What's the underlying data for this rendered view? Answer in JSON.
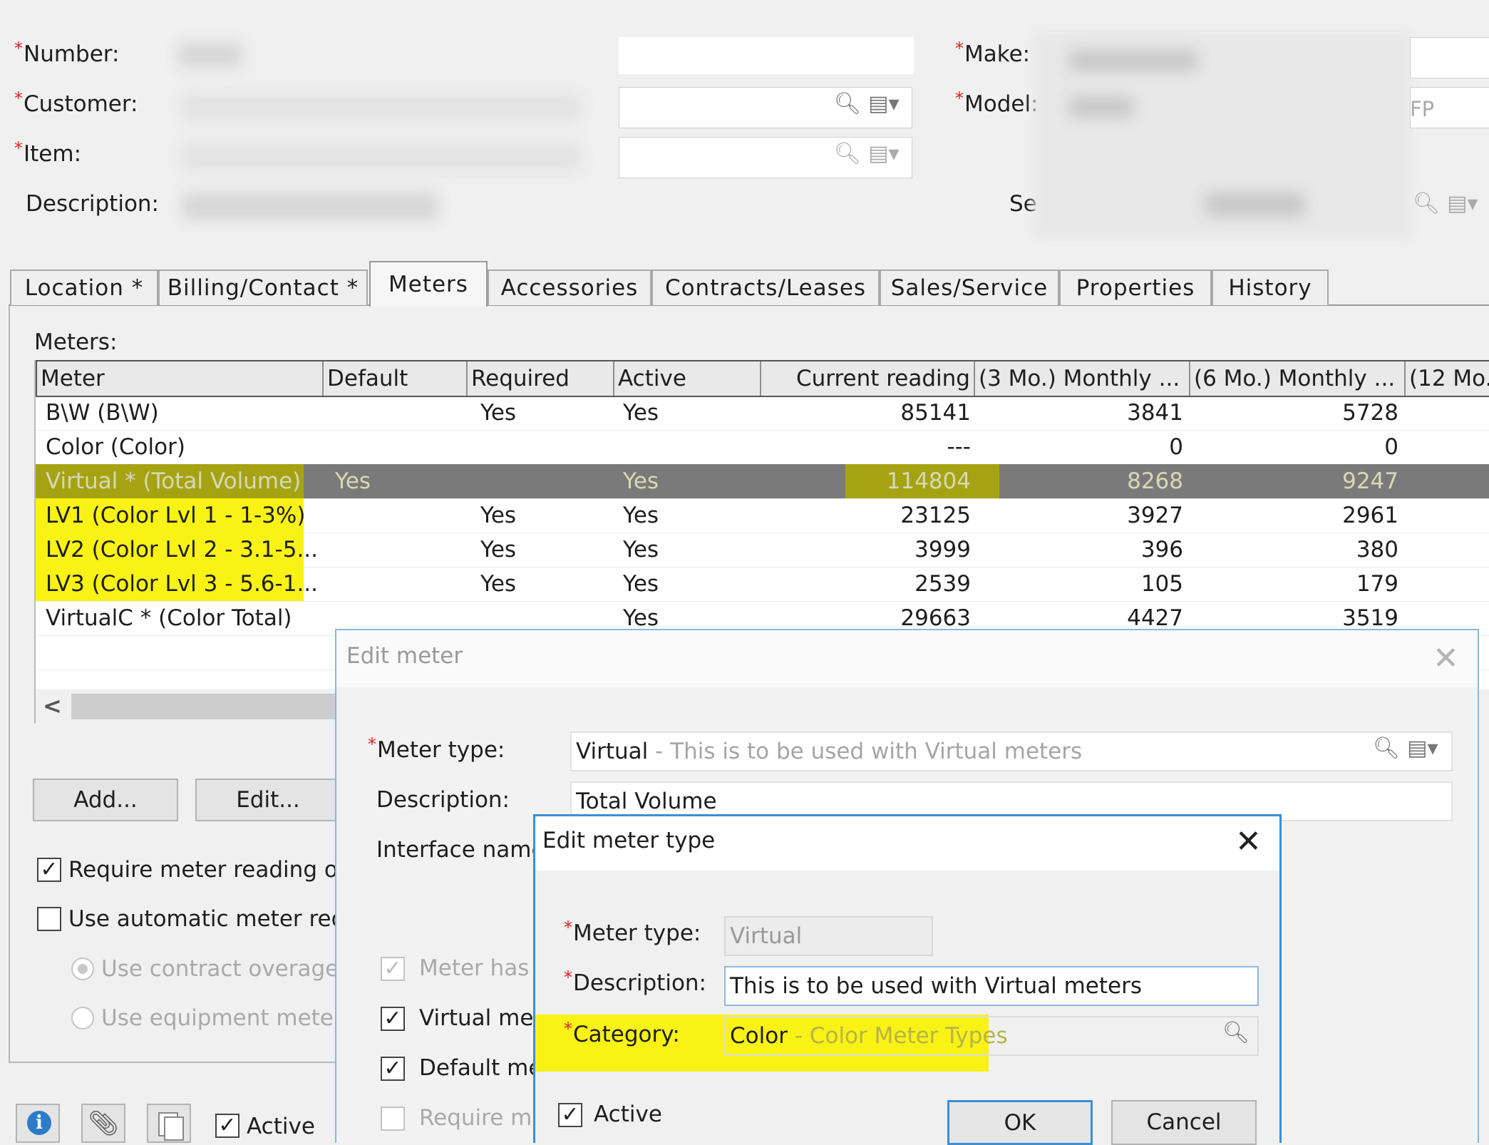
{
  "form": {
    "number_label": "Number:",
    "customer_label": "Customer:",
    "item_label": "Item:",
    "description_label": "Description:",
    "make_label": "Make:",
    "model_label": "Model:",
    "model_suffix": "FP",
    "se_label": "Se",
    "req_mark": "*"
  },
  "tabs": [
    {
      "label": "Location *"
    },
    {
      "label": "Billing/Contact *"
    },
    {
      "label": "Meters"
    },
    {
      "label": "Accessories"
    },
    {
      "label": "Contracts/Leases"
    },
    {
      "label": "Sales/Service"
    },
    {
      "label": "Properties"
    },
    {
      "label": "History"
    }
  ],
  "meters": {
    "section_label": "Meters:",
    "columns": [
      "Meter",
      "Default",
      "Required",
      "Active",
      "Current reading",
      "(3 Mo.) Monthly ...",
      "(6 Mo.) Monthly ...",
      "(12 Mo."
    ],
    "rows": [
      {
        "meter": "B\\W (B\\W)",
        "default": "",
        "required": "Yes",
        "active": "Yes",
        "current": "85141",
        "m3": "3841",
        "m6": "5728"
      },
      {
        "meter": "Color (Color)",
        "default": "",
        "required": "",
        "active": "",
        "current": "---",
        "m3": "0",
        "m6": "0"
      },
      {
        "meter": "Virtual * (Total Volume)",
        "default": "Yes",
        "required": "",
        "active": "Yes",
        "current": "114804",
        "m3": "8268",
        "m6": "9247"
      },
      {
        "meter": "LV1 (Color Lvl 1 - 1-3%)",
        "default": "",
        "required": "Yes",
        "active": "Yes",
        "current": "23125",
        "m3": "3927",
        "m6": "2961"
      },
      {
        "meter": "LV2 (Color Lvl 2 - 3.1-5...",
        "default": "",
        "required": "Yes",
        "active": "Yes",
        "current": "3999",
        "m3": "396",
        "m6": "380"
      },
      {
        "meter": "LV3 (Color Lvl 3 - 5.6-1...",
        "default": "",
        "required": "Yes",
        "active": "Yes",
        "current": "2539",
        "m3": "105",
        "m6": "179"
      },
      {
        "meter": "VirtualC * (Color Total)",
        "default": "",
        "required": "",
        "active": "Yes",
        "current": "29663",
        "m3": "4427",
        "m6": "3519"
      }
    ],
    "add_button": "Add...",
    "edit_button": "Edit...",
    "require_reading_label": "Require meter reading on",
    "use_automatic_label": "Use automatic meter requ",
    "use_contract_label": "Use contract overage",
    "use_equipment_label": "Use equipment meter r",
    "scroll_left": "<"
  },
  "bottom": {
    "active_label": "Active"
  },
  "edit_meter": {
    "title": "Edit meter",
    "meter_type_label": "Meter type:",
    "meter_type_value": "Virtual",
    "meter_type_hint": " - This is to be used with Virtual meters",
    "description_label": "Description:",
    "description_value": "Total Volume",
    "interface_label": "Interface name",
    "meter_has_label": "Meter has",
    "virtual_label": "Virtual met",
    "default_label": "Default me",
    "require_label": "Require me"
  },
  "edit_meter_type": {
    "title": "Edit meter type",
    "meter_type_label": "Meter type:",
    "meter_type_value": "Virtual",
    "description_label": "Description:",
    "description_value": "This is to be used with Virtual meters",
    "category_label": "Category:",
    "category_value": "Color",
    "category_hint": " - Color Meter Types",
    "active_label": "Active",
    "ok_button": "OK",
    "cancel_button": "Cancel"
  },
  "colors": {
    "highlight": "#f8f215",
    "selected_row": "#7a7a7a",
    "required_mark": "#d22222",
    "dialog_border": "#3c8fd6"
  }
}
